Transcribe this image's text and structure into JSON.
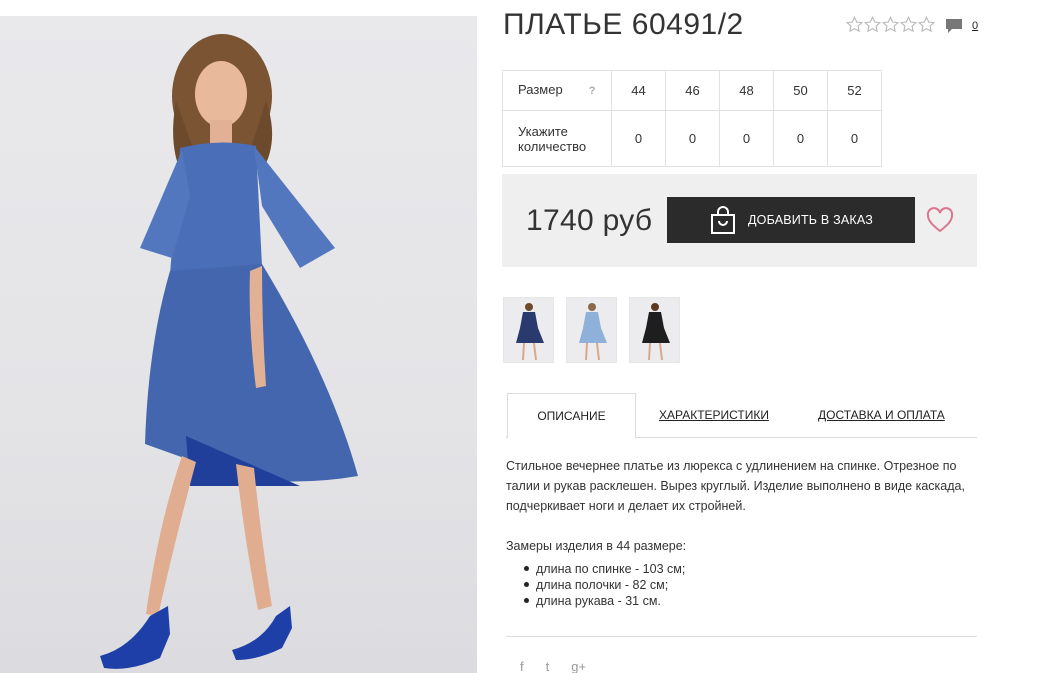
{
  "product": {
    "title": "ПЛАТЬЕ 60491/2",
    "rating": 0,
    "rating_max": 5,
    "comments_count": "0"
  },
  "sizes": {
    "size_label": "Размер",
    "help_mark": "?",
    "quantity_label": "Укажите количество",
    "items": [
      {
        "size": "44",
        "qty": "0"
      },
      {
        "size": "46",
        "qty": "0"
      },
      {
        "size": "48",
        "qty": "0"
      },
      {
        "size": "50",
        "qty": "0"
      },
      {
        "size": "52",
        "qty": "0"
      }
    ]
  },
  "purchase": {
    "price": "1740 руб",
    "order_button": "ДОБАВИТЬ В ЗАКАЗ"
  },
  "tabs": {
    "description": "ОПИСАНИЕ",
    "characteristics": "ХАРАКТЕРИСТИКИ",
    "delivery": "ДОСТАВКА И ОПЛАТА"
  },
  "description": {
    "text": "Стильное вечернее платье из люрекса с удлинением на спинке. Отрезное по талии и рукав расклешен. Вырез круглый. Изделие выполнено в виде каскада, подчеркивает ноги и делает их стройней.",
    "measures_title": "Замеры изделия в 44 размере:",
    "measures": [
      "длина по спинке - 103 см;",
      "длина полочки - 82 см;",
      "длина рукава - 31 см."
    ]
  },
  "share": {
    "facebook": "f",
    "twitter": "t",
    "googleplus": "g+"
  },
  "colors": {
    "dress_blue": "#4a6fb8",
    "dress_navy": "#2b3a6e",
    "dress_black": "#1e1e1e",
    "button_bg": "#2b2b2b",
    "price_bg": "#efefef",
    "heart": "#d9768e"
  },
  "icons": {
    "star": "star-outline-icon",
    "comment": "comment-bubble-icon",
    "bag": "shopping-bag-icon",
    "heart": "heart-outline-icon"
  }
}
